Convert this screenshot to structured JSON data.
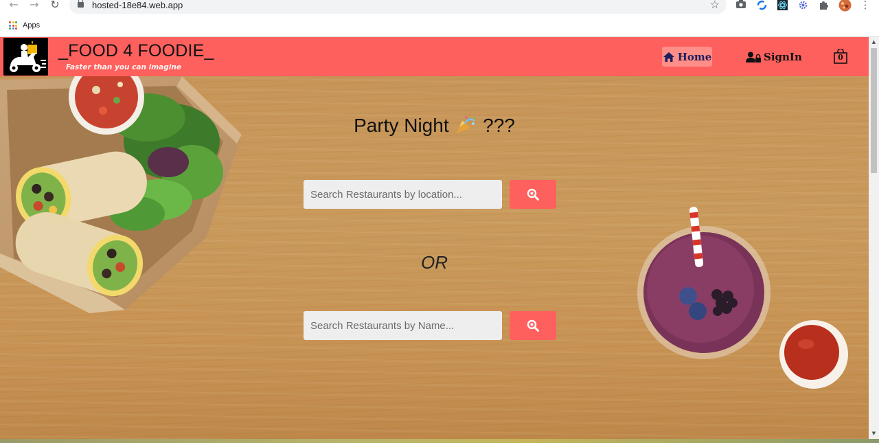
{
  "browser": {
    "url": "hosted-18e84.web.app",
    "bookmarks_apps_label": "Apps"
  },
  "header": {
    "brand": "_FOOD 4 FOODIE_",
    "tagline": "Faster than you can imagine",
    "nav": {
      "home": "Home",
      "signin": "SignIn"
    },
    "cart_count": "0",
    "colors": {
      "header_bg": "#fe605e",
      "home_bg": "#ff8d88"
    }
  },
  "hero": {
    "headline_text": "Party Night",
    "headline_suffix": "???",
    "search_location_placeholder": "Search Restaurants by location...",
    "or_label": "OR",
    "search_name_placeholder": "Search Restaurants by Name..."
  },
  "icons": [
    "back-icon",
    "forward-icon",
    "reload-icon",
    "lock-icon",
    "star-icon",
    "camera-icon",
    "sync-icon",
    "react-icon",
    "settings-icon",
    "puzzle-icon",
    "avatar-icon",
    "menu-icon",
    "apps-icon",
    "scooter-logo-icon",
    "home-icon",
    "user-lock-icon",
    "shopping-bag-icon",
    "search-icon",
    "party-popper-icon"
  ]
}
